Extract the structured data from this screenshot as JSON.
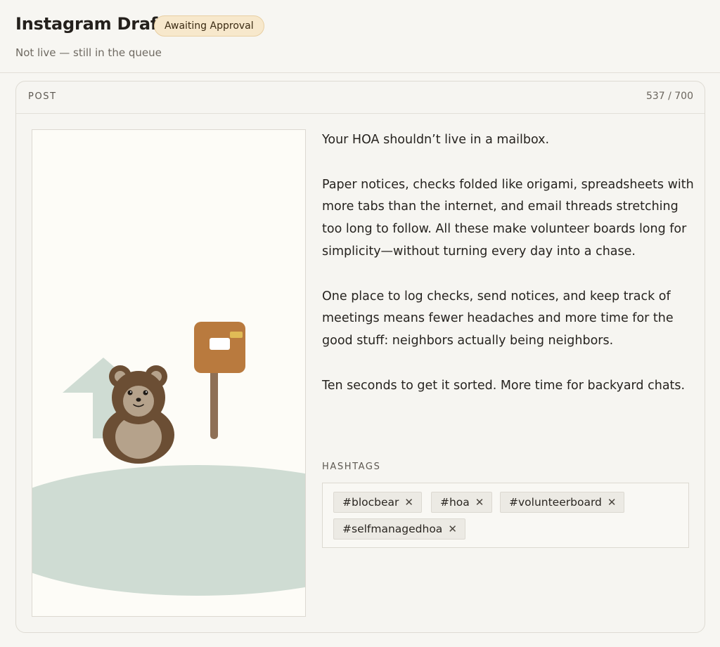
{
  "header": {
    "title": "Instagram Draft",
    "badge": "Awaiting Approval",
    "subtitle": "Not live — still in the queue"
  },
  "post": {
    "section_label": "POST",
    "char_count": "537 / 700",
    "caption": [
      "Your HOA shouldn’t live in a mailbox.",
      "Paper notices, checks folded like origami, spreadsheets with more tabs than the internet, and email threads stretching too long to follow. All these make volunteer boards long for simplicity—without turning every day into a chase.",
      "One place to log checks, send notices, and keep track of meetings means fewer headaches and more time for the good stuff: neighbors actually being neighbors.",
      "Ten seconds to get it sorted. More time for backyard chats."
    ],
    "hashtags_label": "HASHTAGS",
    "hashtags": [
      "#blocbear",
      "#hoa",
      "#volunteerboard",
      "#selfmanagedhoa"
    ],
    "remove_glyph": "✕"
  },
  "colors": {
    "badge_bg": "#f7e8cc",
    "bear": "#6b4e34",
    "bear_belly": "#b5a28b",
    "mailbox": "#b97a3e",
    "ground": "#cfdcd3"
  },
  "illustration": {
    "icons": [
      "house-icon",
      "bear-icon",
      "mailbox-icon"
    ]
  }
}
